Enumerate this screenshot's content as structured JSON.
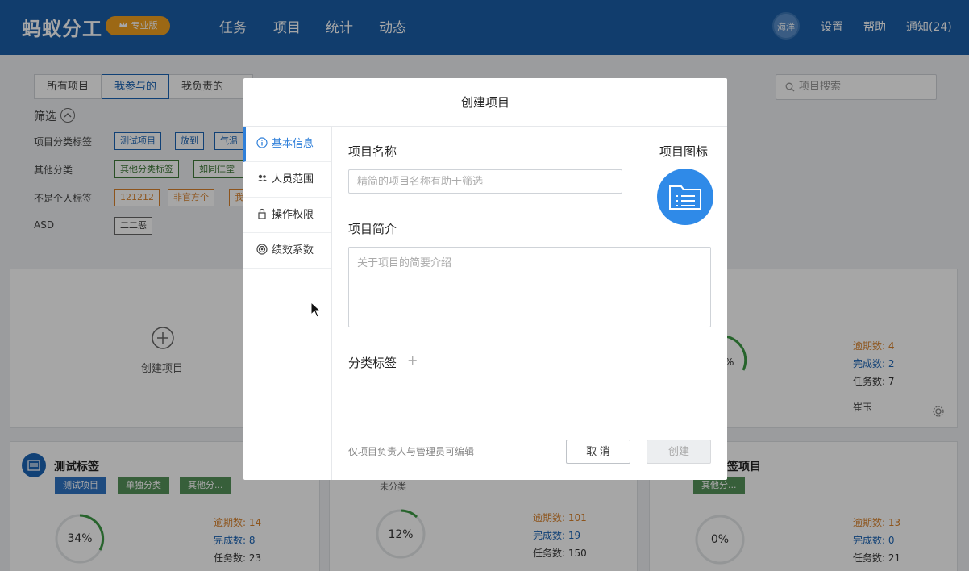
{
  "header": {
    "logo": "蚂蚁分工",
    "pro_badge": "专业版",
    "nav": [
      "任务",
      "项目",
      "统计",
      "动态"
    ],
    "avatar_text": "海洋",
    "settings": "设置",
    "help": "帮助",
    "notifications": "通知(24)",
    "color": "#1b5ea8"
  },
  "page": {
    "tabs": [
      "所有项目",
      "我参与的",
      "我负责的"
    ],
    "active_tab": "我参与的",
    "search_placeholder": "项目搜索",
    "filter_title": "筛选",
    "filters": [
      {
        "label": "项目分类标签",
        "tags": [
          "测试项目",
          "放到",
          "气温"
        ]
      },
      {
        "label": "其他分类",
        "tags": [
          "其他分类标签",
          "如同仁堂"
        ]
      },
      {
        "label": "不是个人标签",
        "tags": [
          "121212",
          "非官方个",
          "我"
        ]
      },
      {
        "label": "ASD",
        "tags": [
          "二二恶"
        ]
      }
    ],
    "create_card_label": "创建项目",
    "cards": [
      {
        "title": "测试标签",
        "tags": [
          "测试项目",
          "单独分类",
          "其他分..."
        ],
        "progress": "34%",
        "overdue_label": "逾期数:",
        "overdue": "14",
        "done_label": "完成数:",
        "done": "8",
        "total_label": "任务数:",
        "total": "23"
      },
      {
        "title": "",
        "tags": [
          "未分类"
        ],
        "progress": "12%",
        "overdue_label": "逾期数:",
        "overdue": "101",
        "done_label": "完成数:",
        "done": "19",
        "total_label": "任务数:",
        "total": "150"
      },
      {
        "title": "签项目",
        "tags": [
          "其他分..."
        ],
        "progress": "0%",
        "overdue_label": "逾期数:",
        "overdue": "13",
        "done_label": "完成数:",
        "done": "0",
        "total_label": "任务数:",
        "total": "21"
      }
    ],
    "top_right_card": {
      "progress_fragment": "%",
      "overdue_label": "逾期数:",
      "overdue": "4",
      "done_label": "完成数:",
      "done": "2",
      "total_label": "任务数:",
      "total": "7",
      "owner": "崔玉"
    }
  },
  "modal": {
    "title": "创建项目",
    "side_nav": [
      {
        "label": "基本信息",
        "icon": "info-icon"
      },
      {
        "label": "人员范围",
        "icon": "people-icon"
      },
      {
        "label": "操作权限",
        "icon": "lock-icon"
      },
      {
        "label": "绩效系数",
        "icon": "target-icon"
      }
    ],
    "name_label": "项目名称",
    "name_placeholder": "精简的项目名称有助于筛选",
    "icon_label": "项目图标",
    "desc_label": "项目简介",
    "desc_placeholder": "关于项目的简要介绍",
    "category_label": "分类标签",
    "add_symbol": "+",
    "hint": "仅项目负责人与管理员可编辑",
    "cancel_label": "取 消",
    "create_label": "创建",
    "accent": "#2f7fd9"
  }
}
